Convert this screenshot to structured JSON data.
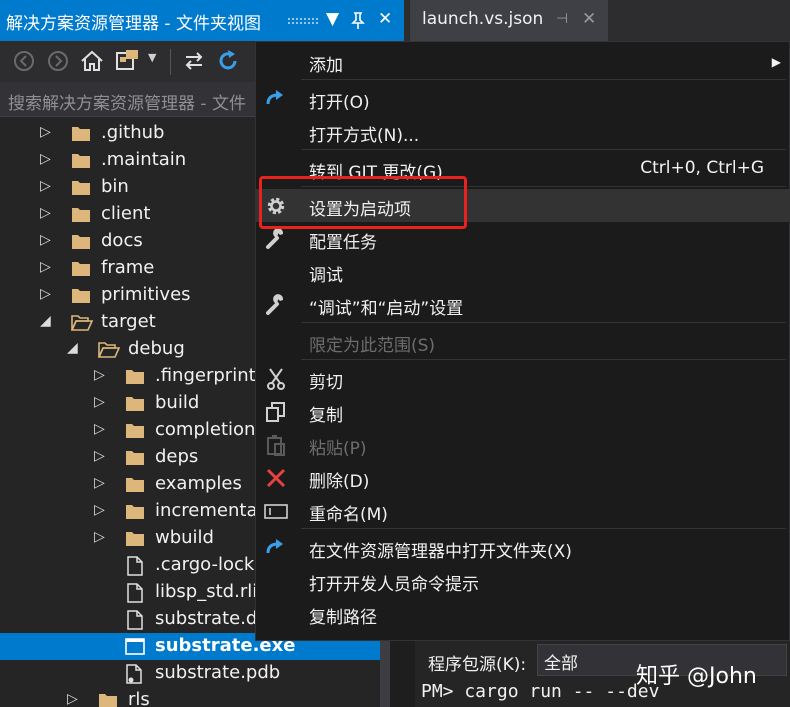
{
  "tabs": [
    {
      "label": "解决方案资源管理器 - 文件夹视图",
      "active": true
    },
    {
      "label": "launch.vs.json",
      "active": false
    }
  ],
  "search": {
    "placeholder": "搜索解决方案资源管理器 - 文件"
  },
  "tree": [
    {
      "label": ".github",
      "type": "folder",
      "depth": 0,
      "expanded": false
    },
    {
      "label": ".maintain",
      "type": "folder",
      "depth": 0,
      "expanded": false
    },
    {
      "label": "bin",
      "type": "folder",
      "depth": 0,
      "expanded": false
    },
    {
      "label": "client",
      "type": "folder",
      "depth": 0,
      "expanded": false
    },
    {
      "label": "docs",
      "type": "folder",
      "depth": 0,
      "expanded": false
    },
    {
      "label": "frame",
      "type": "folder",
      "depth": 0,
      "expanded": false
    },
    {
      "label": "primitives",
      "type": "folder",
      "depth": 0,
      "expanded": false
    },
    {
      "label": "target",
      "type": "folder",
      "depth": 0,
      "expanded": true
    },
    {
      "label": "debug",
      "type": "folder",
      "depth": 1,
      "expanded": true
    },
    {
      "label": ".fingerprint",
      "type": "folder",
      "depth": 2,
      "expanded": false
    },
    {
      "label": "build",
      "type": "folder",
      "depth": 2,
      "expanded": false
    },
    {
      "label": "completions",
      "type": "folder",
      "depth": 2,
      "expanded": false
    },
    {
      "label": "deps",
      "type": "folder",
      "depth": 2,
      "expanded": false
    },
    {
      "label": "examples",
      "type": "folder",
      "depth": 2,
      "expanded": false
    },
    {
      "label": "incremental",
      "type": "folder",
      "depth": 2,
      "expanded": false
    },
    {
      "label": "wbuild",
      "type": "folder",
      "depth": 2,
      "expanded": false
    },
    {
      "label": ".cargo-lock",
      "type": "file",
      "depth": 2
    },
    {
      "label": "libsp_std.rlib",
      "type": "file",
      "depth": 2
    },
    {
      "label": "substrate.d",
      "type": "file",
      "depth": 2
    },
    {
      "label": "substrate.exe",
      "type": "exe",
      "depth": 2,
      "selected": true
    },
    {
      "label": "substrate.pdb",
      "type": "pdb",
      "depth": 2
    },
    {
      "label": "rls",
      "type": "folder",
      "depth": 1,
      "expanded": false
    }
  ],
  "menu": [
    {
      "label": "添加",
      "icon": "",
      "submenu": true
    },
    {
      "sep": true
    },
    {
      "label": "打开(O)",
      "icon": "open-arrow-icon"
    },
    {
      "label": "打开方式(N)...",
      "icon": ""
    },
    {
      "sep": true
    },
    {
      "label": "转到 GIT 更改(G)",
      "icon": "",
      "shortcut": "Ctrl+0, Ctrl+G"
    },
    {
      "sep": true
    },
    {
      "label": "设置为启动项",
      "icon": "gear-icon",
      "hover": true
    },
    {
      "label": "配置任务",
      "icon": "wrench-icon"
    },
    {
      "label": "调试",
      "icon": ""
    },
    {
      "label": "“调试”和“启动”设置",
      "icon": "wrench-icon"
    },
    {
      "sep": true
    },
    {
      "label": "限定为此范围(S)",
      "icon": "",
      "disabled": true
    },
    {
      "sep": true
    },
    {
      "label": "剪切",
      "icon": "scissors-icon"
    },
    {
      "label": "复制",
      "icon": "copy-icon"
    },
    {
      "label": "粘贴(P)",
      "icon": "paste-icon",
      "disabled": true
    },
    {
      "label": "删除(D)",
      "icon": "delete-x-icon"
    },
    {
      "label": "重命名(M)",
      "icon": "rename-icon"
    },
    {
      "sep": true
    },
    {
      "label": "在文件资源管理器中打开文件夹(X)",
      "icon": "open-arrow-icon"
    },
    {
      "label": "打开开发人员命令提示",
      "icon": ""
    },
    {
      "label": "复制路径",
      "icon": ""
    }
  ],
  "package_manager": {
    "source_label": "程序包源(K):",
    "source_value": "全部",
    "console_line": "PM> cargo run -- --dev"
  },
  "watermark": "知乎 @John",
  "colors": {
    "accent": "#007acc",
    "highlight_box": "#e8231f",
    "delete": "#e8423f"
  }
}
